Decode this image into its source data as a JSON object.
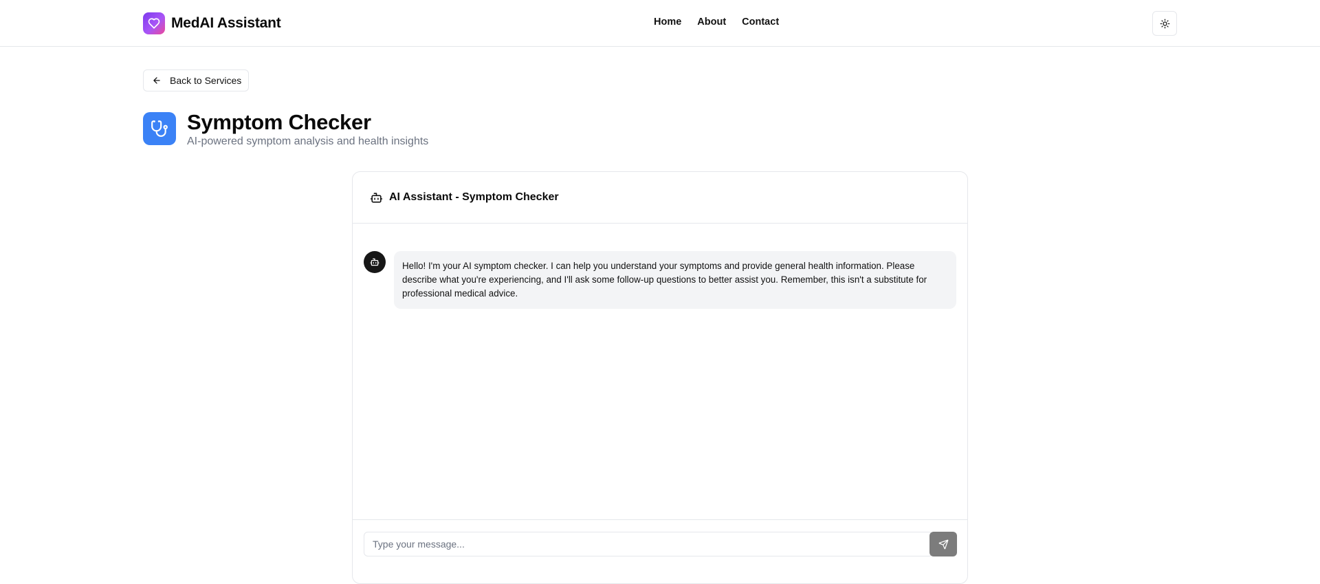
{
  "header": {
    "brand_name": "MedAI Assistant",
    "brand_icon": "heart-icon",
    "nav": [
      {
        "label": "Home"
      },
      {
        "label": "About"
      },
      {
        "label": "Contact"
      }
    ],
    "theme_toggle_icon": "sun-icon"
  },
  "back_button": {
    "label": "Back to Services",
    "icon": "arrow-left-icon"
  },
  "page": {
    "title": "Symptom Checker",
    "subtitle": "AI-powered symptom analysis and health insights",
    "icon": "stethoscope-icon",
    "icon_color": "#3b82f6"
  },
  "chat": {
    "title": "AI Assistant - Symptom Checker",
    "title_icon": "bot-icon",
    "messages": [
      {
        "role": "assistant",
        "avatar_icon": "bot-icon",
        "text": "Hello! I'm your AI symptom checker. I can help you understand your symptoms and provide general health information. Please describe what you're experiencing, and I'll ask some follow-up questions to better assist you. Remember, this isn't a substitute for professional medical advice."
      }
    ],
    "input": {
      "value": "",
      "placeholder": "Type your message..."
    },
    "send_icon": "send-icon"
  },
  "colors": {
    "brand_gradient_start": "#7c3aed",
    "brand_gradient_end": "#ec4899",
    "accent_blue": "#3b82f6",
    "send_button": "#7c7c7c"
  }
}
